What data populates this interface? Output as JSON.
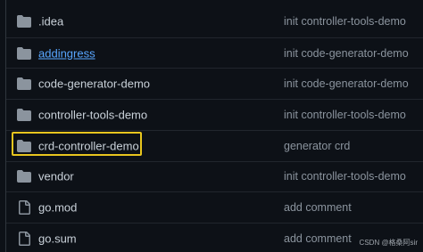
{
  "rows": [
    {
      "icon": "folder-icon",
      "name": "​.idea",
      "message": "init controller-tools-demo",
      "link": false
    },
    {
      "icon": "folder-icon",
      "name": "addingress",
      "message": "init code-generator-demo",
      "link": true
    },
    {
      "icon": "folder-icon",
      "name": "code-generator-demo",
      "message": "init code-generator-demo",
      "link": false
    },
    {
      "icon": "folder-icon",
      "name": "controller-tools-demo",
      "message": "init controller-tools-demo",
      "link": false
    },
    {
      "icon": "folder-icon",
      "name": "crd-controller-demo",
      "message": "generator crd",
      "link": false
    },
    {
      "icon": "folder-icon",
      "name": "vendor",
      "message": "init controller-tools-demo",
      "link": false
    },
    {
      "icon": "file-icon",
      "name": "go.mod",
      "message": "add comment",
      "link": false
    },
    {
      "icon": "file-icon",
      "name": "go.sum",
      "message": "add comment",
      "link": false
    }
  ],
  "watermark": "CSDN @格桑阿sir",
  "colors": {
    "background": "#0d1117",
    "text": "#c9d1d9",
    "muted": "#8b949e",
    "link": "#58a6ff",
    "highlight": "#e8c51e"
  }
}
